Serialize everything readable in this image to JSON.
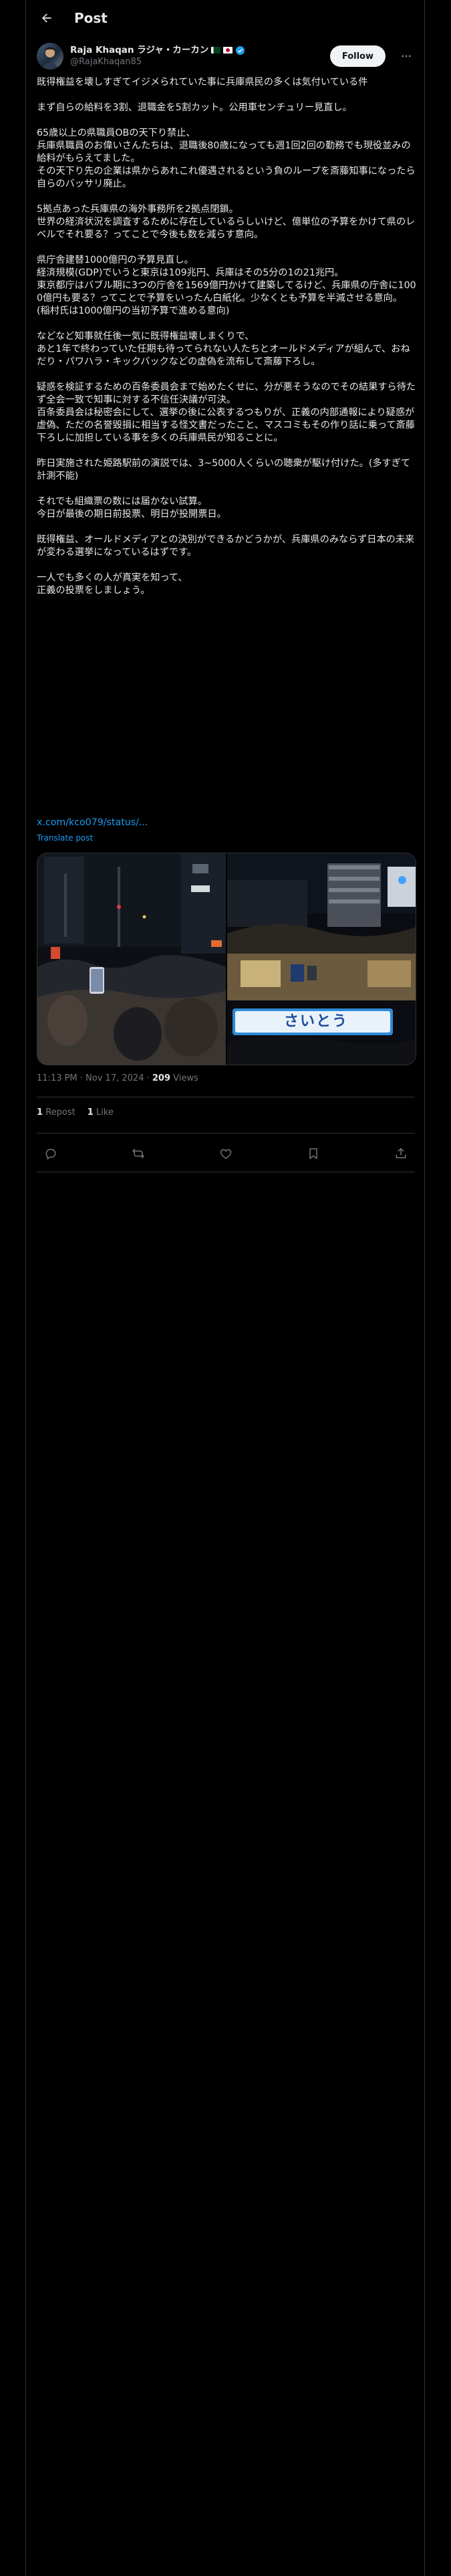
{
  "header": {
    "title": "Post"
  },
  "author": {
    "name": "Raja Khaqan ラジャ・カーカン",
    "handle": "@RajaKhaqan85",
    "follow_label": "Follow"
  },
  "post": {
    "body": "既得権益を壊しすぎてイジメられていた事に兵庫県民の多くは気付いている件\n\nまず自らの給料を3割、退職金を5割カット。公用車センチュリー見直し。\n\n65歳以上の県職員OBの天下り禁止、\n兵庫県職員のお偉いさんたちは、退職後80歳になっても週1回2回の勤務でも現役並みの給料がもらえてました。\nその天下り先の企業は県からあれこれ優遇されるという負のループを斎藤知事になったら自らのバッサリ廃止。\n\n5拠点あった兵庫県の海外事務所を2拠点閉鎖。\n世界の経済状況を調査するために存在しているらしいけど、億単位の予算をかけて県のレベルでそれ要る？ってことで今後も数を減らす意向。\n\n県庁舎建替1000億円の予算見直し。\n経済規模(GDP)でいうと東京は109兆円、兵庫はその5分の1の21兆円。\n東京都庁はバブル期に3つの庁舎を1569億円かけて建築してるけど、兵庫県の庁舎に1000億円も要る？ってことで予算をいったん白紙化。少なくとも予算を半減させる意向。\n(稲村氏は1000億円の当初予算で進める意向)\n\nなどなど知事就任後一気に既得権益壊しまくりで、\nあと1年で終わっていた任期も待ってられない人たちとオールドメディアが組んで、おねだり・パワハラ・キックバックなどの虚偽を流布して斎藤下ろし。\n\n疑惑を検証するための百条委員会まで始めたくせに、分が悪そうなのでその結果すら待たず全会一致で知事に対する不信任決議が可決。\n百条委員会は秘密会にして、選挙の後に公表するつもりが、正義の内部通報により疑惑が虚偽、ただの名誉毀損に相当する怪文書だったこと、マスコミもその作り話に乗って斎藤下ろしに加担している事を多くの兵庫県民が知ることに。\n\n昨日実施された姫路駅前の演説では、3~5000人くらいの聴衆が駆け付けた。(多すぎて計測不能)\n\nそれでも組織票の数には届かない試算。\n今日が最後の期日前投票、明日が投開票日。\n\n既得権益、オールドメディアとの決別ができるかどうかが、兵庫県のみならず日本の未来が変わる選挙になっているはずです。\n\n一人でも多くの人が真実を知って、\n正義の投票をしましょう。",
    "link": "x.com/kco079/status/...",
    "translate": "Translate post",
    "image_sign_text": "さいとう",
    "time": "11:13 PM · Nov 17, 2024",
    "views_count": "209",
    "views_label": "Views",
    "reposts_count": "1",
    "reposts_label": "Repost",
    "likes_count": "1",
    "likes_label": "Like"
  },
  "colors": {
    "accent": "#1d9bf0",
    "background": "#000000",
    "muted": "#71767b",
    "border": "#2f3336"
  },
  "icons": [
    "back-arrow-icon",
    "verified-icon",
    "more-icon",
    "reply-icon",
    "repost-icon",
    "like-icon",
    "bookmark-icon",
    "share-icon"
  ]
}
